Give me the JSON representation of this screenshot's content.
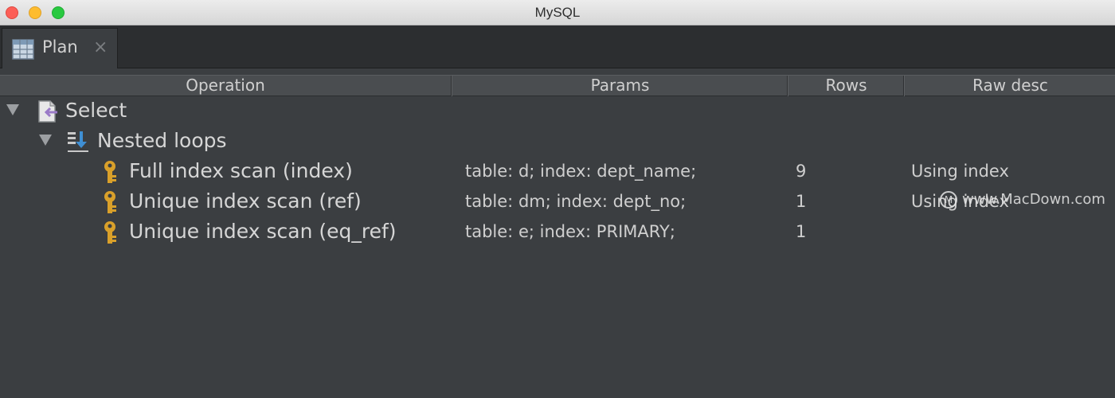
{
  "window": {
    "title": "MySQL"
  },
  "tab": {
    "label": "Plan",
    "close": "×"
  },
  "columns": [
    "Operation",
    "Params",
    "Rows",
    "Raw desc"
  ],
  "tree": {
    "root": {
      "label": "Select",
      "icon": "select-icon",
      "expanded": true
    },
    "child": {
      "label": "Nested loops",
      "icon": "nested-loops-icon",
      "expanded": true
    },
    "leaves": [
      {
        "operation": "Full index scan (index)",
        "params": "table: d; index: dept_name;",
        "rows": "9",
        "raw": "Using index",
        "icon": "key-icon"
      },
      {
        "operation": "Unique index scan (ref)",
        "params": "table: dm; index: dept_no;",
        "rows": "1",
        "raw": "Using index",
        "icon": "key-icon"
      },
      {
        "operation": "Unique index scan (eq_ref)",
        "params": "table: e; index: PRIMARY;",
        "rows": "1",
        "raw": "",
        "icon": "key-icon"
      }
    ]
  },
  "watermark": {
    "text": "www.MacDown.com"
  },
  "colors": {
    "key": "#d9a02a",
    "select_arrow": "#9b7bc8",
    "nested_arrow": "#3f8fd4"
  }
}
